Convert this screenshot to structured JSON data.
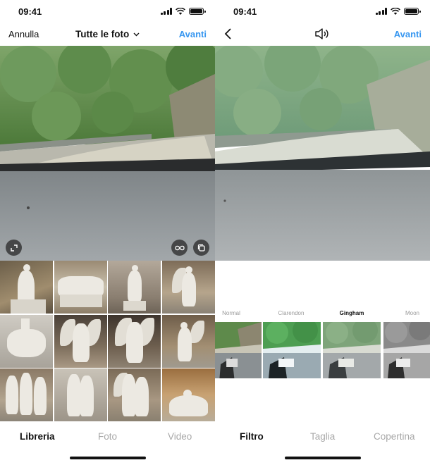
{
  "left_screen": {
    "status_time": "09:41",
    "nav": {
      "cancel_label": "Annulla",
      "title": "Tutte le foto",
      "next_label": "Avanti"
    },
    "icons": {
      "expand": "expand-icon",
      "boomerang": "infinity-icon",
      "multi_select": "multiple-select-icon",
      "title_dropdown": "chevron-down-icon"
    },
    "tabs": [
      {
        "label": "Libreria",
        "active": true
      },
      {
        "label": "Foto",
        "active": false
      },
      {
        "label": "Video",
        "active": false
      }
    ]
  },
  "right_screen": {
    "status_time": "09:41",
    "nav": {
      "next_label": "Avanti"
    },
    "icons": {
      "back": "chevron-left-icon",
      "sound": "speaker-icon"
    },
    "filters": [
      {
        "label": "Normal",
        "active": false
      },
      {
        "label": "Clarendon",
        "active": false
      },
      {
        "label": "Gingham",
        "active": true
      },
      {
        "label": "Moon",
        "active": false
      }
    ],
    "tabs": [
      {
        "label": "Filtro",
        "active": true
      },
      {
        "label": "Taglia",
        "active": false
      },
      {
        "label": "Copertina",
        "active": false
      }
    ]
  },
  "colors": {
    "accent": "#3897f0",
    "inactive_tab": "#a8a8a8"
  }
}
